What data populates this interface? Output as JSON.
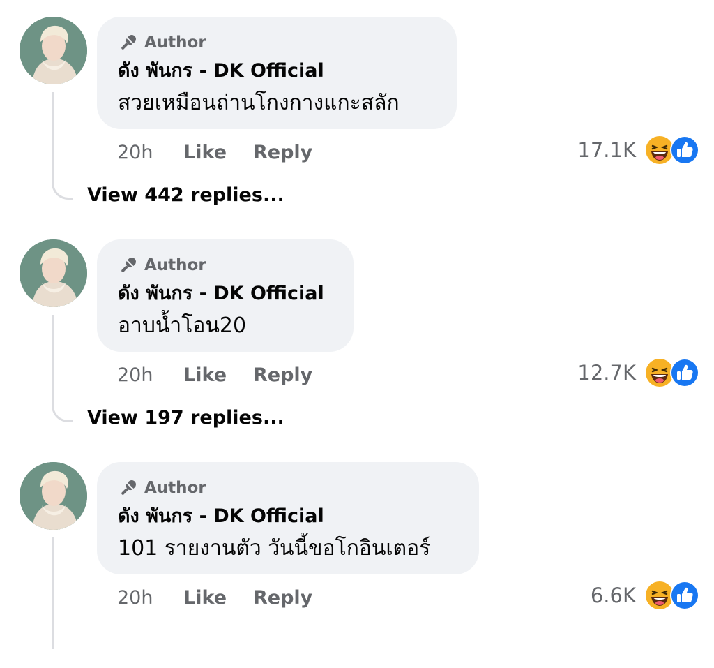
{
  "comments": [
    {
      "badge": "Author",
      "author": "ดัง พันกร - DK Official",
      "text": "สวยเหมือนถ่านโกงกางแกะสลัก",
      "time": "20h",
      "like_label": "Like",
      "reply_label": "Reply",
      "reaction_count": "17.1K",
      "reaction_icons": [
        "haha-icon",
        "like-icon"
      ],
      "view_replies": "View 442 replies..."
    },
    {
      "badge": "Author",
      "author": "ดัง พันกร - DK Official",
      "text": "อาบน้ำโอน20",
      "time": "20h",
      "like_label": "Like",
      "reply_label": "Reply",
      "reaction_count": "12.7K",
      "reaction_icons": [
        "haha-icon",
        "like-icon"
      ],
      "view_replies": "View 197 replies..."
    },
    {
      "badge": "Author",
      "author": "ดัง พันกร - DK Official",
      "text": "101 รายงานตัว วันนี้ขอโกอินเตอร์",
      "time": "20h",
      "like_label": "Like",
      "reply_label": "Reply",
      "reaction_count": "6.6K",
      "reaction_icons": [
        "haha-icon",
        "like-icon"
      ]
    }
  ],
  "colors": {
    "bubble": "#f0f2f5",
    "secondary_text": "#65676b",
    "primary_text": "#050505",
    "like_blue": "#1877f2",
    "haha_yellow": "#f7b125"
  }
}
